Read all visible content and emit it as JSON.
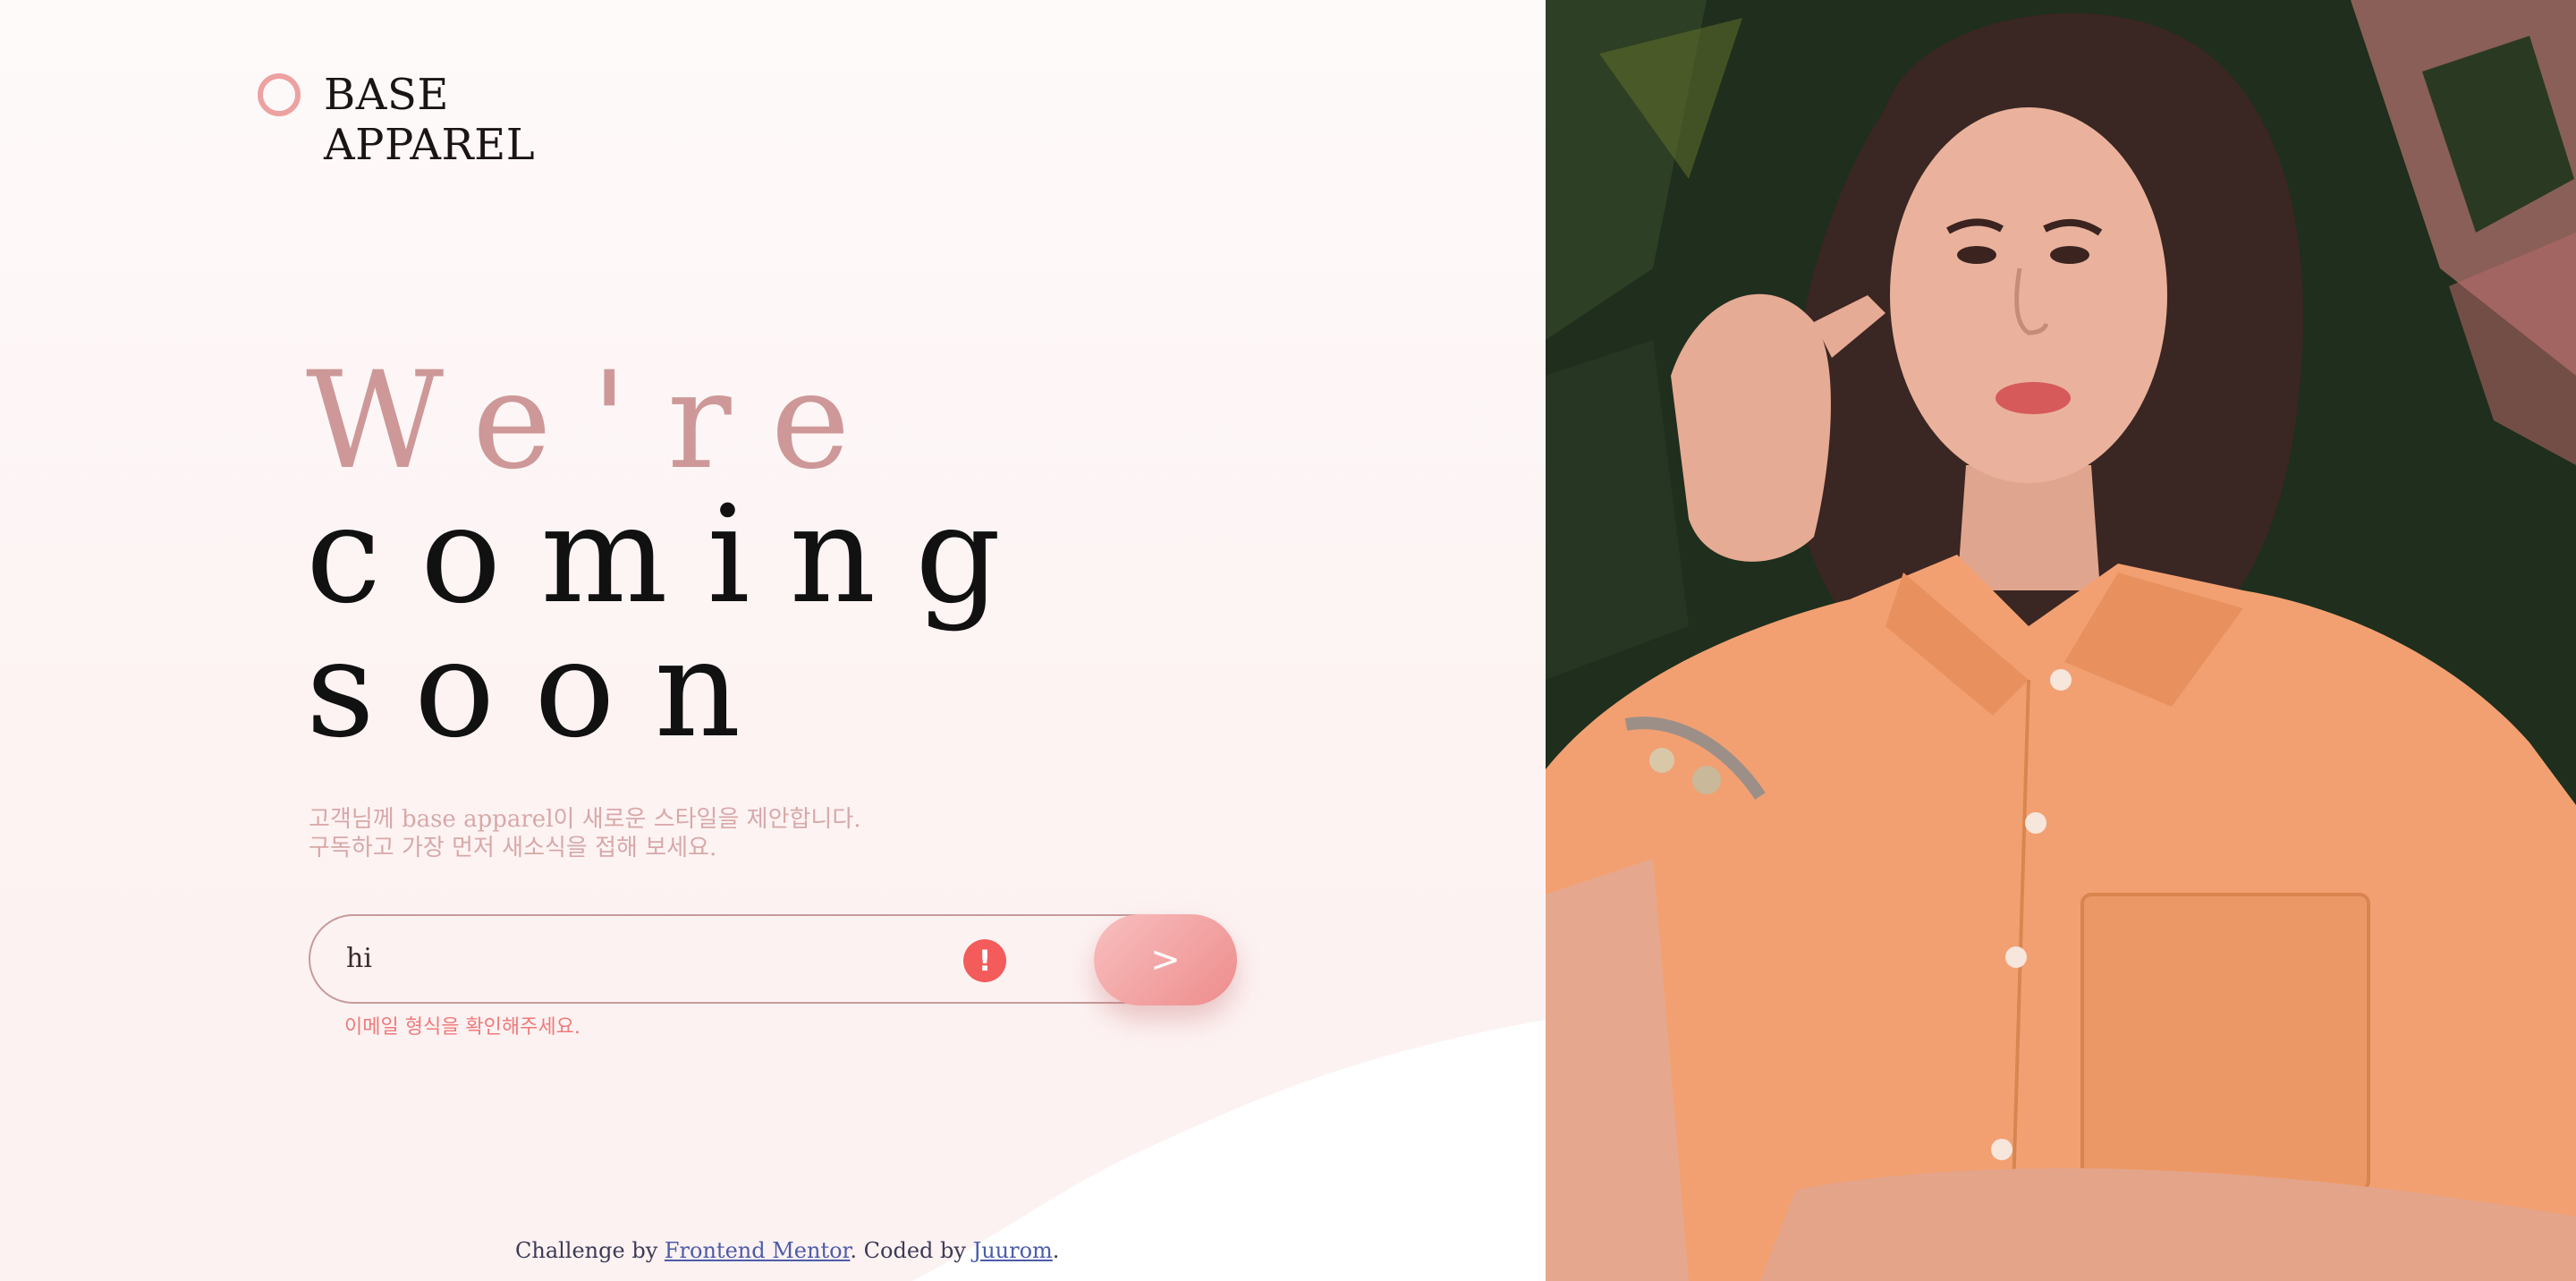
{
  "brand": {
    "line1": "BASE",
    "line2": "APPAREL"
  },
  "headline": {
    "line1": "We're",
    "line2": "coming",
    "line3": "soon"
  },
  "intro": {
    "line1": "고객님께 base apparel이 새로운 스타일을 제안합니다.",
    "line2": "구독하고 가장 먼저 새소식을 접해 보세요."
  },
  "form": {
    "email_value": "hi",
    "submit_label": ">",
    "error_glyph": "!",
    "error_message": "이메일 형식을 확인해주세요."
  },
  "footer": {
    "prefix": "Challenge by ",
    "link1": "Frontend Mentor",
    "middle": ". Coded by ",
    "link2": "Juurom",
    "suffix": "."
  },
  "colors": {
    "accent": "#ce9898",
    "error": "#f45b5b",
    "button": "#ee8c8c"
  },
  "icons": {
    "logo": "ring-logo-icon",
    "error": "exclamation-circle-icon"
  }
}
